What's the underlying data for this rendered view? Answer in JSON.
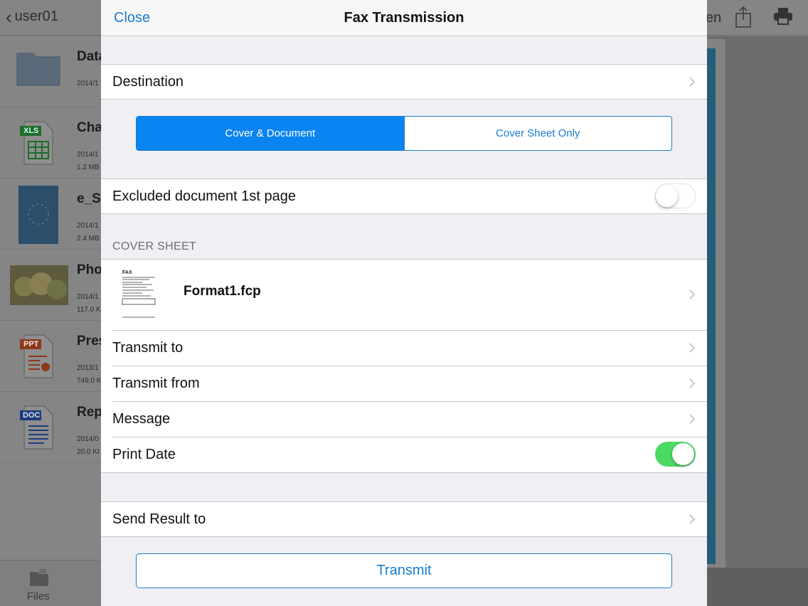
{
  "background": {
    "back_label": "user01",
    "open_label_partial": "en",
    "files": [
      {
        "name": "Data",
        "meta1": "2014/1",
        "meta2": "",
        "kind": "folder"
      },
      {
        "name": "Cha",
        "meta1": "2014/1",
        "meta2": "1.2 MB",
        "kind": "xls",
        "badge": "XLS"
      },
      {
        "name": "e_S",
        "meta1": "2014/1",
        "meta2": "2.4 MB",
        "kind": "pdf"
      },
      {
        "name": "Pho",
        "meta1": "2014/1",
        "meta2": "117.0 K",
        "kind": "photo"
      },
      {
        "name": "Pres",
        "meta1": "2013/1",
        "meta2": "749.0 K",
        "kind": "ppt",
        "badge": "PPT"
      },
      {
        "name": "Rep",
        "meta1": "2014/0",
        "meta2": "20.0 KI",
        "kind": "doc",
        "badge": "DOC"
      }
    ],
    "tab_files": "Files"
  },
  "modal": {
    "close_label": "Close",
    "title": "Fax Transmission",
    "destination_label": "Destination",
    "segment": {
      "options": [
        "Cover & Document",
        "Cover Sheet Only"
      ],
      "selected": "Cover & Document"
    },
    "excluded_label": "Excluded document 1st page",
    "excluded_on": false,
    "cover_sheet_header": "COVER SHEET",
    "cover_format": "Format1.fcp",
    "thumb_label": "FAX",
    "transmit_to_label": "Transmit to",
    "transmit_from_label": "Transmit from",
    "message_label": "Message",
    "print_date_label": "Print Date",
    "print_date_on": true,
    "send_result_label": "Send Result to",
    "transmit_button": "Transmit"
  },
  "colors": {
    "accent": "#1a7ccf",
    "segment_active": "#0a84f0",
    "toggle_on": "#4cd964",
    "group_bg": "#efeff4"
  }
}
